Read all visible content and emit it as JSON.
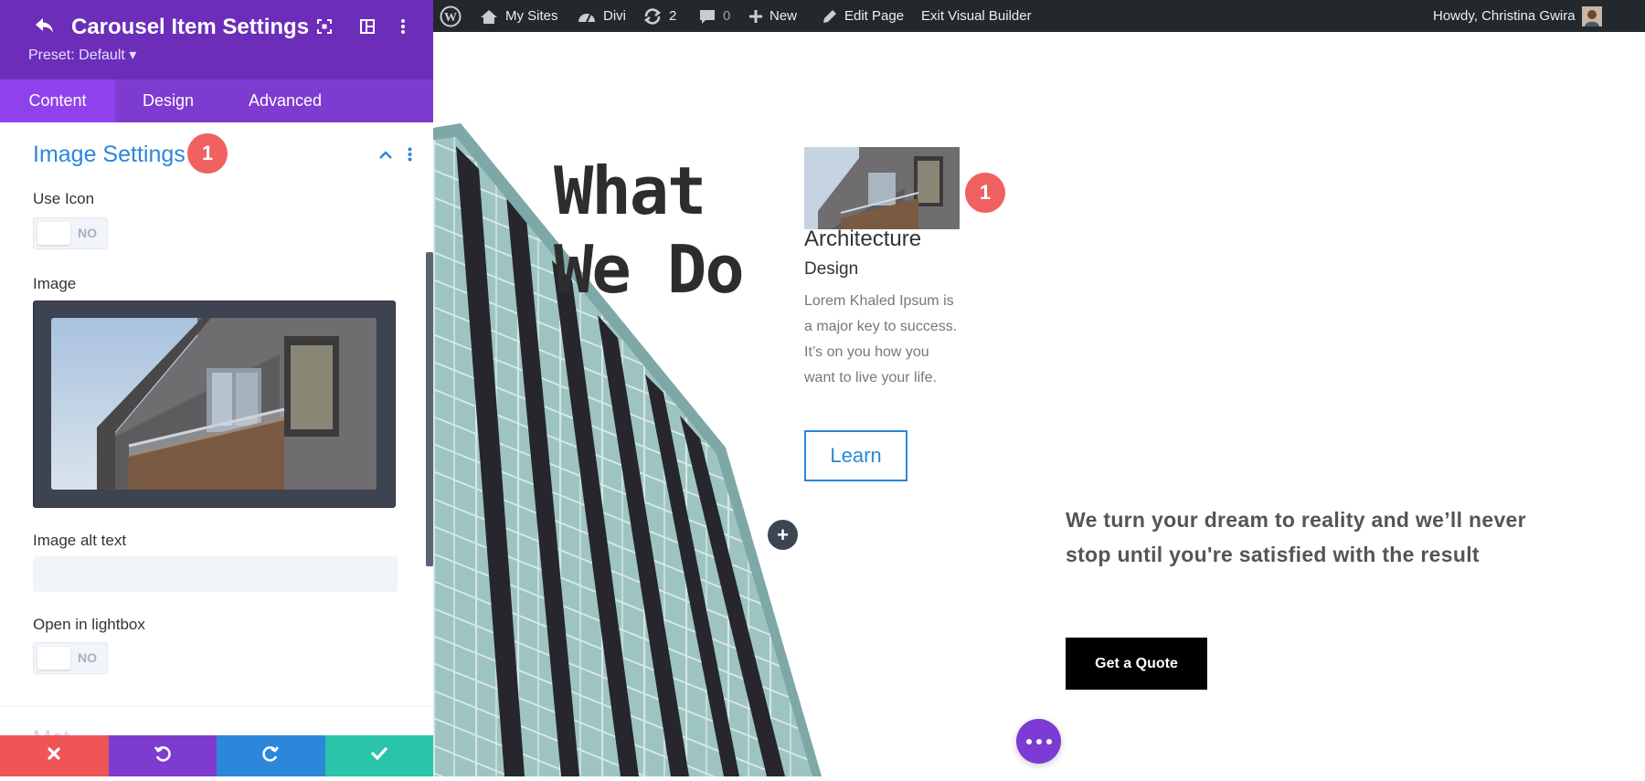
{
  "admin_bar": {
    "my_sites": "My Sites",
    "divi": "Divi",
    "updates_count": "2",
    "comments_count": "0",
    "new": "New",
    "edit_page": "Edit Page",
    "exit_builder": "Exit Visual Builder",
    "greeting": "Howdy, Christina Gwira"
  },
  "panel": {
    "title": "Carousel Item Settings",
    "preset": "Preset: Default ▾",
    "tabs": [
      {
        "label": "Content",
        "active": true
      },
      {
        "label": "Design",
        "active": false
      },
      {
        "label": "Advanced",
        "active": false
      }
    ],
    "section": {
      "title": "Image Settings",
      "badge": "1"
    },
    "fields": {
      "use_icon_label": "Use Icon",
      "use_icon_value": "NO",
      "image_label": "Image",
      "alt_text_label": "Image alt text",
      "alt_text_value": "",
      "lightbox_label": "Open in lightbox",
      "lightbox_value": "NO"
    },
    "next_section_partial": "Met"
  },
  "page": {
    "heading_line1": "What",
    "heading_line2": "We Do",
    "card": {
      "title": "Architecture",
      "subtitle": "Design",
      "body": "Lorem Khaled Ipsum is a major key to success. It’s on you how you want to live your life.",
      "button": "Learn",
      "badge": "1"
    },
    "tagline": "We turn your dream to reality and we’ll never stop until you're satisfied with the result",
    "cta": "Get a Quote"
  },
  "colors": {
    "purple_header": "#6c2eb9",
    "accent_blue": "#2b87da",
    "badge_red": "#ef6161",
    "cancel": "#ef5555",
    "undo": "#7e3bd0",
    "redo": "#2b87da",
    "save": "#29c4a9"
  }
}
